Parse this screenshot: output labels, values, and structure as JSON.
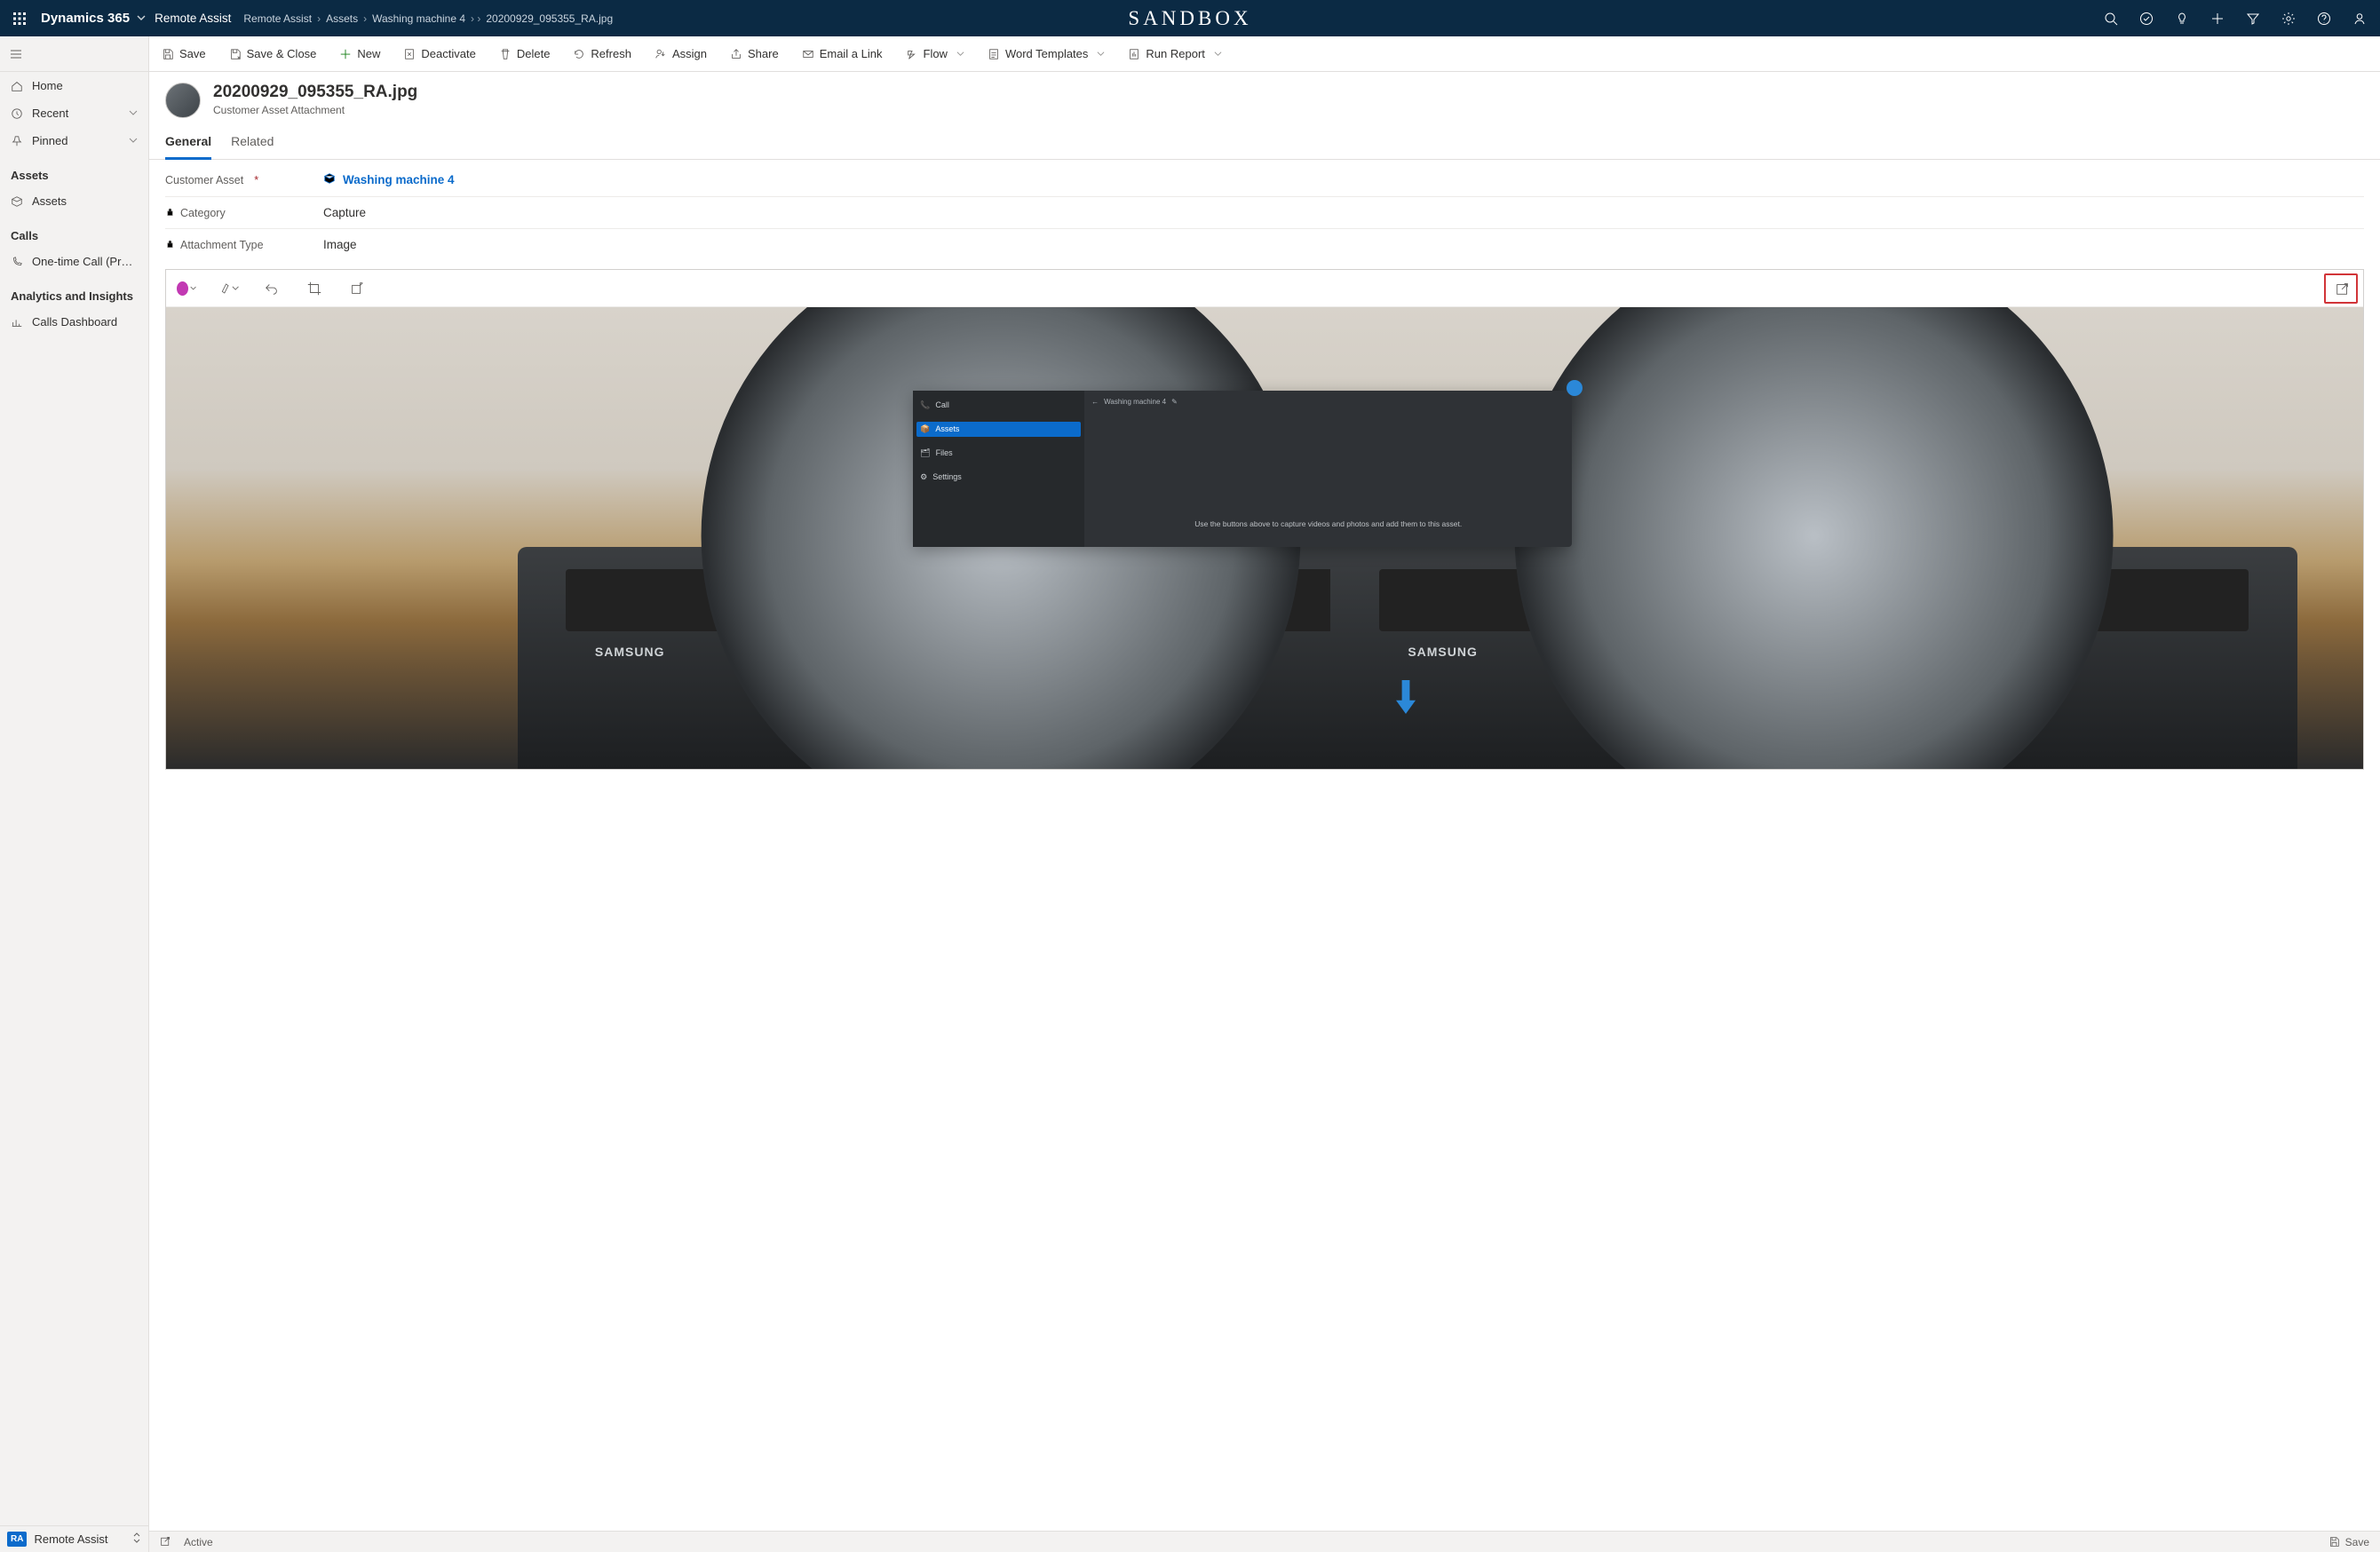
{
  "topbar": {
    "brand": "Dynamics 365",
    "appname": "Remote Assist",
    "sandbox": "SANDBOX",
    "breadcrumbs": [
      "Remote Assist",
      "Assets",
      "Washing machine 4",
      "20200929_095355_RA.jpg"
    ]
  },
  "leftnav": {
    "home": "Home",
    "recent": "Recent",
    "pinned": "Pinned",
    "group_assets": "Assets",
    "assets": "Assets",
    "group_calls": "Calls",
    "onetime": "One-time Call (Previ...",
    "group_analytics": "Analytics and Insights",
    "calls_dashboard": "Calls Dashboard",
    "bottom_badge": "RA",
    "bottom_label": "Remote Assist"
  },
  "cmd": {
    "save": "Save",
    "save_close": "Save & Close",
    "new": "New",
    "deactivate": "Deactivate",
    "delete": "Delete",
    "refresh": "Refresh",
    "assign": "Assign",
    "share": "Share",
    "email": "Email a Link",
    "flow": "Flow",
    "word": "Word Templates",
    "report": "Run Report"
  },
  "record": {
    "title": "20200929_095355_RA.jpg",
    "subtitle": "Customer Asset Attachment"
  },
  "tabs": {
    "general": "General",
    "related": "Related"
  },
  "fields": {
    "customer_asset_label": "Customer Asset",
    "customer_asset_value": "Washing machine 4",
    "category_label": "Category",
    "category_value": "Capture",
    "attachment_type_label": "Attachment Type",
    "attachment_type_value": "Image"
  },
  "mr": {
    "title": "Washing machine 4",
    "call": "Call",
    "assets": "Assets",
    "files": "Files",
    "settings": "Settings",
    "msg": "Use the buttons above to capture videos and photos and add them to this asset."
  },
  "wm": {
    "brand1": "SAMSUNG",
    "brand2": "SAMSUNG"
  },
  "status": {
    "active": "Active",
    "save": "Save"
  }
}
